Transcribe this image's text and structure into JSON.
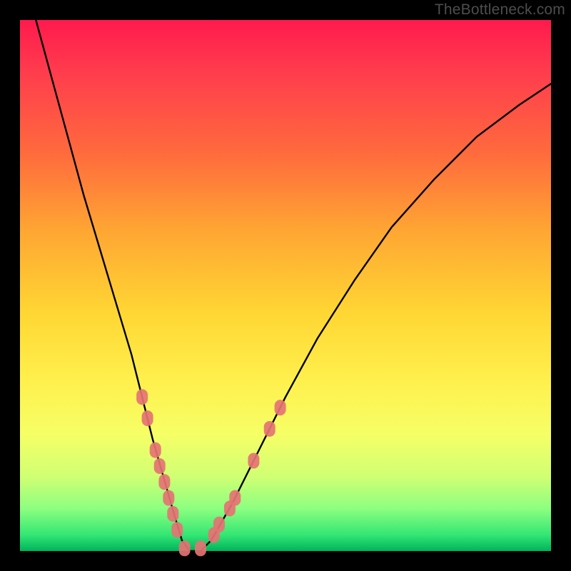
{
  "watermark": "TheBottleneck.com",
  "chart_data": {
    "type": "line",
    "title": "",
    "xlabel": "",
    "ylabel": "",
    "xlim": [
      0,
      100
    ],
    "ylim": [
      0,
      100
    ],
    "grid": false,
    "legend": false,
    "series": [
      {
        "name": "bottleneck-curve",
        "x": [
          3,
          6,
          9,
          12,
          15,
          18,
          21,
          23,
          25,
          27,
          29,
          30.5,
          32,
          34,
          36,
          40,
          45,
          50,
          56,
          63,
          70,
          78,
          86,
          94,
          100
        ],
        "y": [
          100,
          89,
          78,
          67,
          57,
          47,
          37,
          29,
          21,
          14,
          7,
          2,
          0,
          0,
          2,
          9,
          19,
          29,
          40,
          51,
          61,
          70,
          78,
          84,
          88
        ]
      }
    ],
    "markers": {
      "name": "highlighted-points",
      "shape": "rounded-capsule",
      "color": "#e57373",
      "points": [
        {
          "x": 23.0,
          "y": 29
        },
        {
          "x": 24.0,
          "y": 25
        },
        {
          "x": 25.5,
          "y": 19
        },
        {
          "x": 26.3,
          "y": 16
        },
        {
          "x": 27.2,
          "y": 13
        },
        {
          "x": 28.0,
          "y": 10
        },
        {
          "x": 28.8,
          "y": 7
        },
        {
          "x": 29.6,
          "y": 4
        },
        {
          "x": 31.0,
          "y": 0.5
        },
        {
          "x": 34.0,
          "y": 0.5
        },
        {
          "x": 36.5,
          "y": 3
        },
        {
          "x": 37.5,
          "y": 5
        },
        {
          "x": 39.5,
          "y": 8
        },
        {
          "x": 40.5,
          "y": 10
        },
        {
          "x": 44.0,
          "y": 17
        },
        {
          "x": 47.0,
          "y": 23
        },
        {
          "x": 49.0,
          "y": 27
        }
      ]
    }
  }
}
